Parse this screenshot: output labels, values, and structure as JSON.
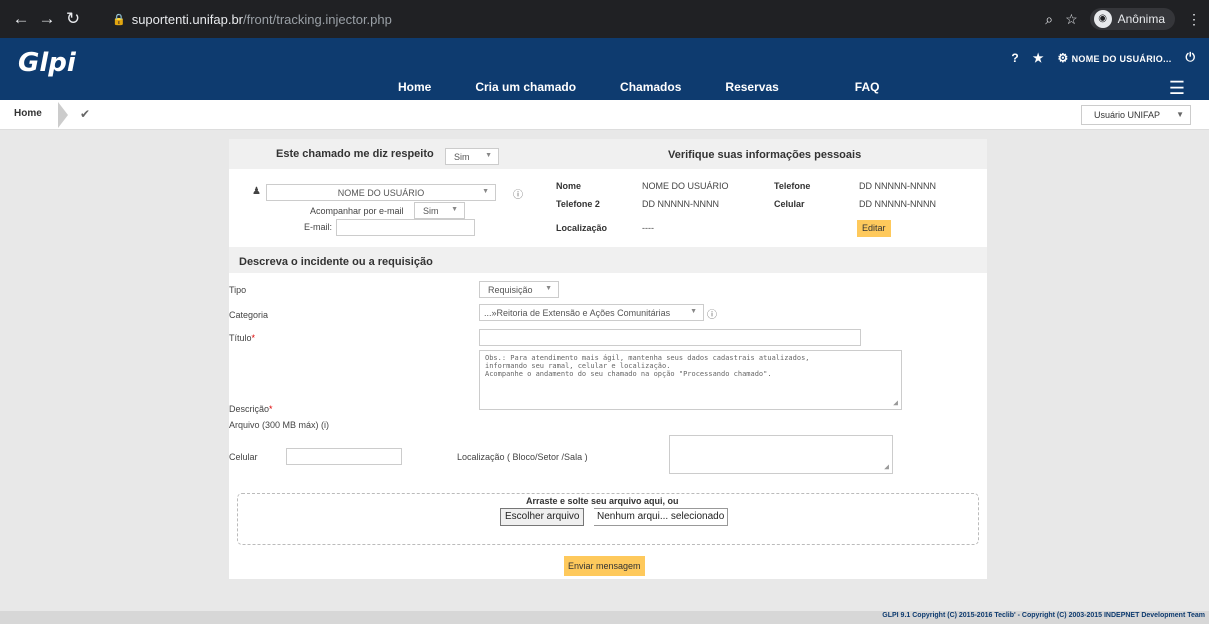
{
  "browser": {
    "url_host": "suportenti.unifap.br",
    "url_path": "/front/tracking.injector.php",
    "incognito_label": "Anônima"
  },
  "header": {
    "logo": "Glpi",
    "help": "?",
    "user_name": "NOME DO USUÁRIO..."
  },
  "menu": [
    {
      "label": "Home"
    },
    {
      "label": "Cria um chamado"
    },
    {
      "label": "Chamados"
    },
    {
      "label": "Reservas"
    },
    {
      "label": "FAQ"
    }
  ],
  "breadcrumb": {
    "home": "Home"
  },
  "profile": {
    "selected": "Usuário UNIFAP"
  },
  "requester": {
    "concerns_label": "Este chamado me diz respeito",
    "concerns_value": "Sim",
    "verify_title": "Verifique suas informações pessoais",
    "user_select": "NOME DO USUÁRIO",
    "follow_email_label": "Acompanhar por e-mail",
    "follow_email_value": "Sim",
    "email_label": "E-mail:",
    "info": {
      "name_label": "Nome",
      "name_value": "NOME DO USUÁRIO",
      "phone_label": "Telefone",
      "phone_value": "DD NNNNN-NNNN",
      "phone2_label": "Telefone 2",
      "phone2_value": "DD NNNNN-NNNN",
      "mobile_label": "Celular",
      "mobile_value": "DD NNNNN-NNNN",
      "location_label": "Localização",
      "location_value": "----",
      "edit_button": "Editar"
    }
  },
  "ticket": {
    "section_title": "Descreva o incidente ou a requisição",
    "type_label": "Tipo",
    "type_value": "Requisição",
    "category_label": "Categoria",
    "category_value": "...»Reitoria de Extensão e Ações Comunitárias",
    "title_label": "Título",
    "required_mark": "*",
    "description_label": "Descrição",
    "description_text": "Obs.: Para atendimento mais ágil, mantenha seus dados cadastrais atualizados,\ninformando seu ramal, celular e localização.\nAcompanhe o andamento do seu chamado na opção \"Processando chamado\".",
    "file_label": "Arquivo (300 MB máx) (i)",
    "mobile_label": "Celular",
    "location_label": "Localização ( Bloco/Setor /Sala )",
    "dropzone_text": "Arraste e solte seu arquivo aqui, ou",
    "choose_file": "Escolher arquivo",
    "no_file": "Nenhum arqui... selecionado",
    "submit": "Enviar mensagem"
  },
  "footer": {
    "text": "GLPI 9.1 Copyright (C) 2015-2016 Teclib' - Copyright (C) 2003-2015 INDEPNET Development Team"
  }
}
